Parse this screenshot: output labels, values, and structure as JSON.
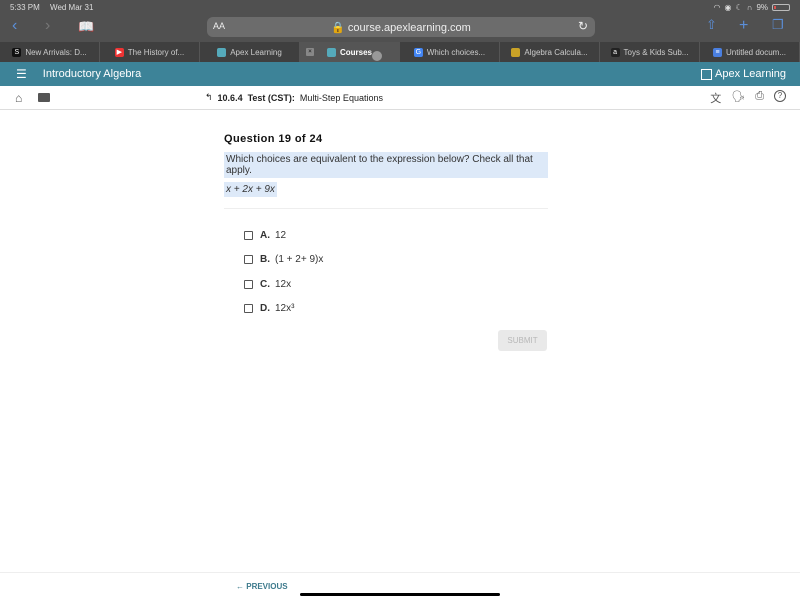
{
  "status_bar": {
    "time": "5:33 PM",
    "date": "Wed Mar 31",
    "battery": "9%"
  },
  "browser": {
    "text_size_label": "AA",
    "url": "course.apexlearning.com",
    "tabs": [
      {
        "label": "New Arrivals: D...",
        "icon": "S",
        "color": "#111"
      },
      {
        "label": "The History of...",
        "icon": "▶",
        "color": "#e33"
      },
      {
        "label": "Apex Learning",
        "icon": "",
        "color": "#5ab"
      },
      {
        "label": "Courses",
        "icon": "",
        "color": "#5ab",
        "active": true
      },
      {
        "label": "Which choices...",
        "icon": "G",
        "color": "#4285f4"
      },
      {
        "label": "Algebra Calcula...",
        "icon": "",
        "color": "#c9a227"
      },
      {
        "label": "Toys & Kids Sub...",
        "icon": "a",
        "color": "#222"
      },
      {
        "label": "Untitled docum...",
        "icon": "≡",
        "color": "#4a7fe0"
      }
    ]
  },
  "app": {
    "course_title": "Introductory Algebra",
    "brand": "Apex Learning",
    "accent": "#3d8398"
  },
  "toolbar": {
    "section_number": "10.6.4",
    "section_type": "Test (CST):",
    "section_title": "Multi-Step Equations"
  },
  "question": {
    "header": "Question 19 of 24",
    "prompt": "Which choices are equivalent to the expression below? Check all that apply.",
    "expression": "x + 2x + 9x",
    "choices": [
      {
        "letter": "A.",
        "text": "12",
        "checked": false
      },
      {
        "letter": "B.",
        "text": "(1 + 2+ 9)x",
        "checked": false
      },
      {
        "letter": "C.",
        "text": "12x",
        "checked": false
      },
      {
        "letter": "D.",
        "text": "12x³",
        "checked": false
      }
    ],
    "submit_label": "SUBMIT"
  },
  "footer": {
    "previous_label": "PREVIOUS"
  }
}
